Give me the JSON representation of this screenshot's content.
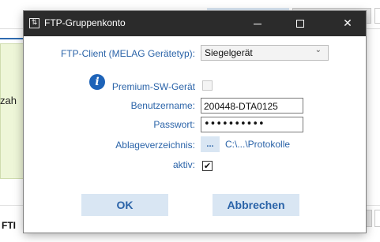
{
  "background": {
    "partial_text_left": "zah",
    "partial_text_bottom": "FTI"
  },
  "dialog": {
    "title": "FTP-Gruppenkonto",
    "app_icon_glyph": "⇅",
    "window_controls": {
      "minimize_icon": "minimize-icon",
      "maximize_icon": "maximize-icon",
      "close_glyph": "✕"
    }
  },
  "form": {
    "ftp_client": {
      "label": "FTP-Client (MELAG Gerätetyp):",
      "selected": "Siegelgerät",
      "chevron": "⌄"
    },
    "premium": {
      "info_glyph": "i",
      "label": "Premium-SW-Gerät",
      "checked": false,
      "enabled": false
    },
    "username": {
      "label": "Benutzername:",
      "value": "200448-DTA0125"
    },
    "password": {
      "label": "Passwort:",
      "masked_value": "••••••••••"
    },
    "directory": {
      "label": "Ablageverzeichnis:",
      "browse_label": "...",
      "path": "C:\\...\\Protokolle"
    },
    "aktiv": {
      "label": "aktiv:",
      "checked": true,
      "check_glyph": "✔"
    }
  },
  "buttons": {
    "ok_label": "OK",
    "cancel_label": "Abbrechen"
  },
  "colors": {
    "title_bar": "#2b2b2b",
    "label_blue": "#2a63a8",
    "button_bg": "#d9e6f3",
    "info_icon": "#1e63b8",
    "bg_panel_green": "#eef6d8"
  }
}
